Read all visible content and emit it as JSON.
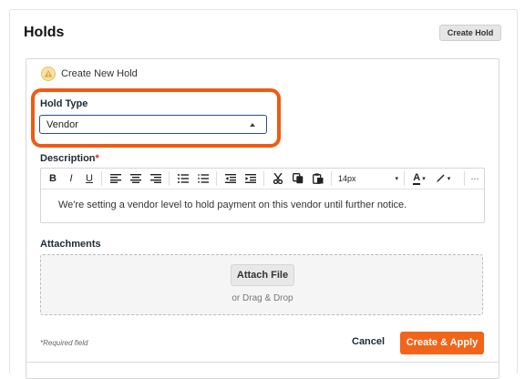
{
  "header": {
    "title": "Holds",
    "create_hold_label": "Create Hold"
  },
  "panel": {
    "heading": "Create New Hold",
    "heading_icon": "warning-icon"
  },
  "hold_type": {
    "label": "Hold Type",
    "value": "Vendor"
  },
  "description": {
    "label": "Description",
    "required_marker": "*",
    "text": "We're setting a vendor level to hold payment on this vendor until further notice."
  },
  "toolbar": {
    "bold": "B",
    "italic": "I",
    "underline": "U",
    "font_size": "14px",
    "text_color": "A",
    "more": "···"
  },
  "attachments": {
    "label": "Attachments",
    "attach_label": "Attach File",
    "drag_text": "or Drag & Drop"
  },
  "footer": {
    "required_note": "*Required field",
    "cancel_label": "Cancel",
    "create_apply_label": "Create & Apply"
  },
  "colors": {
    "accent": "#f26419",
    "highlight": "#ef5b12",
    "select_border": "#2b4b8f",
    "required": "#d92d20"
  }
}
